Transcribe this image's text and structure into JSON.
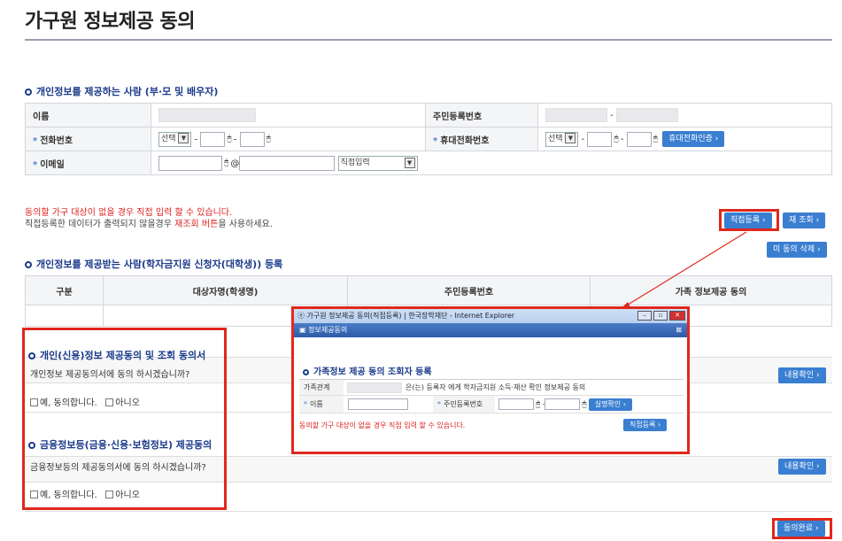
{
  "page": {
    "title": "가구원 정보제공 동의"
  },
  "provider_section": {
    "title": "개인정보를 제공하는 사람 (부·모 및 배우자)",
    "name_label": "이름",
    "rrn_label": "주민등록번호",
    "phone_label": "전화번호",
    "phone_select": "선택",
    "mobile_label": "휴대전화번호",
    "mobile_select": "선택",
    "phone_verify_button": "휴대전화인증",
    "email_label": "이메일",
    "email_at": "@",
    "email_domain_select": "직접입력"
  },
  "notes": {
    "line1": "동의할 가구 대상이 없을 경우 직접 입력 할 수 있습니다.",
    "line2_prefix": "직접등록한 데이터가 출력되지 않을경우 ",
    "line2_red": "재조회 버튼",
    "line2_suffix": "을 사용하세요."
  },
  "buttons": {
    "direct_register": "직접등록",
    "re_query": "재 조회",
    "delete_unagreed": "미 동의 삭제",
    "view_content_1": "내용확인",
    "view_content_2": "내용확인",
    "complete": "동의완료"
  },
  "recipient_section": {
    "title": "개인정보를 제공받는 사람(학자금지원 신청자(대학생)) 등록",
    "columns": [
      "구분",
      "대상자명(학생명)",
      "주민등록번호",
      "가족 정보제공 동의"
    ]
  },
  "consent1": {
    "title": "개인(신용)정보 제공동의 및 조회 동의서",
    "question": "개인정보 제공동의서에 동의 하시겠습니까?",
    "yes": "예, 동의합니다.",
    "no": "아니오"
  },
  "consent2": {
    "title": "금융정보등(금융·신용·보험정보) 제공동의",
    "question": "금융정보등의 제공동의서에 동의 하시겠습니까?",
    "yes": "예, 동의합니다.",
    "no": "아니오"
  },
  "popup": {
    "window_title": "가구원 정보제공 동의(직접등록) | 한국장학재단 - Internet Explorer",
    "header": "정보제공동의",
    "section_title": "가족정보 제공 동의 조회자 등록",
    "relation_label": "가족관계",
    "relation_text": "은(는) 등록자 에게 학자금지원 소득·재산 확인 정보제공 동의",
    "name_label": "이름",
    "rrn_label": "주민등록번호",
    "verify_button": "실명확인",
    "note": "동의할 가구 대상이 없을 경우 직접 입력 할 수 있습니다.",
    "register_button": "직접등록"
  },
  "colors": {
    "accent": "#3a7ed1",
    "highlight": "#e0281c",
    "section": "#1a3a8a"
  }
}
